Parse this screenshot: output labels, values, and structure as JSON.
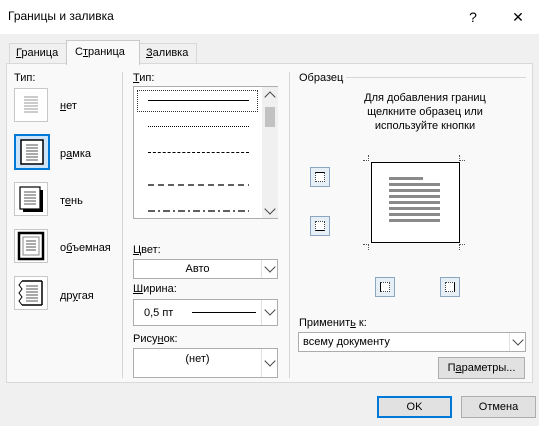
{
  "window": {
    "title": "Границы и заливка",
    "help": "?",
    "close": "✕"
  },
  "tabs": [
    {
      "label": "Граница",
      "underline": "Г",
      "rest": "раница"
    },
    {
      "label": "Страница",
      "pre": "С",
      "underline": "т",
      "rest": "раница"
    },
    {
      "label": "Заливка",
      "underline": "З",
      "rest": "аливка"
    }
  ],
  "setting": {
    "label": "Тип:",
    "items": [
      {
        "label": "нет",
        "underline": "н",
        "rest": "ет"
      },
      {
        "label": "рамка",
        "pre": "р",
        "underline": "а",
        "rest": "мка",
        "selected": true
      },
      {
        "label": "тень",
        "pre": "т",
        "underline": "е",
        "rest": "нь"
      },
      {
        "label": "объемная",
        "pre": "о",
        "underline": "б",
        "rest": "ъемная"
      },
      {
        "label": "другая",
        "pre": "др",
        "underline": "у",
        "rest": "гая"
      }
    ]
  },
  "style": {
    "label": "Тип:",
    "underline": "Т",
    "rest": "ип:",
    "options": [
      "solid",
      "dotted",
      "dashed",
      "long-dash",
      "dash-dot"
    ]
  },
  "color": {
    "label": "Цвет:",
    "underline": "Ц",
    "rest": "вет:",
    "value": "Авто"
  },
  "width": {
    "label": "Ширина:",
    "underline": "Ш",
    "rest": "ирина:",
    "value": "0,5 пт"
  },
  "art": {
    "label": "Рисунок:",
    "pre": "Рису",
    "underline": "н",
    "rest": "ок:",
    "value": "(нет)"
  },
  "preview": {
    "label": "Образец",
    "hint": "Для добавления границ щелкните образец или используйте кнопки"
  },
  "apply_to": {
    "label": "Применить к:",
    "pre": "Применит",
    "underline": "ь",
    "rest": " к:",
    "value": "всему документу"
  },
  "buttons": {
    "options": "Параметры...",
    "options_pre": "П",
    "options_underline": "а",
    "options_rest": "раметры...",
    "ok": "OK",
    "cancel": "Отмена"
  },
  "colors": {
    "accent": "#0078d7",
    "selected_bg": "#cce4f7",
    "window_bg": "#f0f0f0"
  }
}
